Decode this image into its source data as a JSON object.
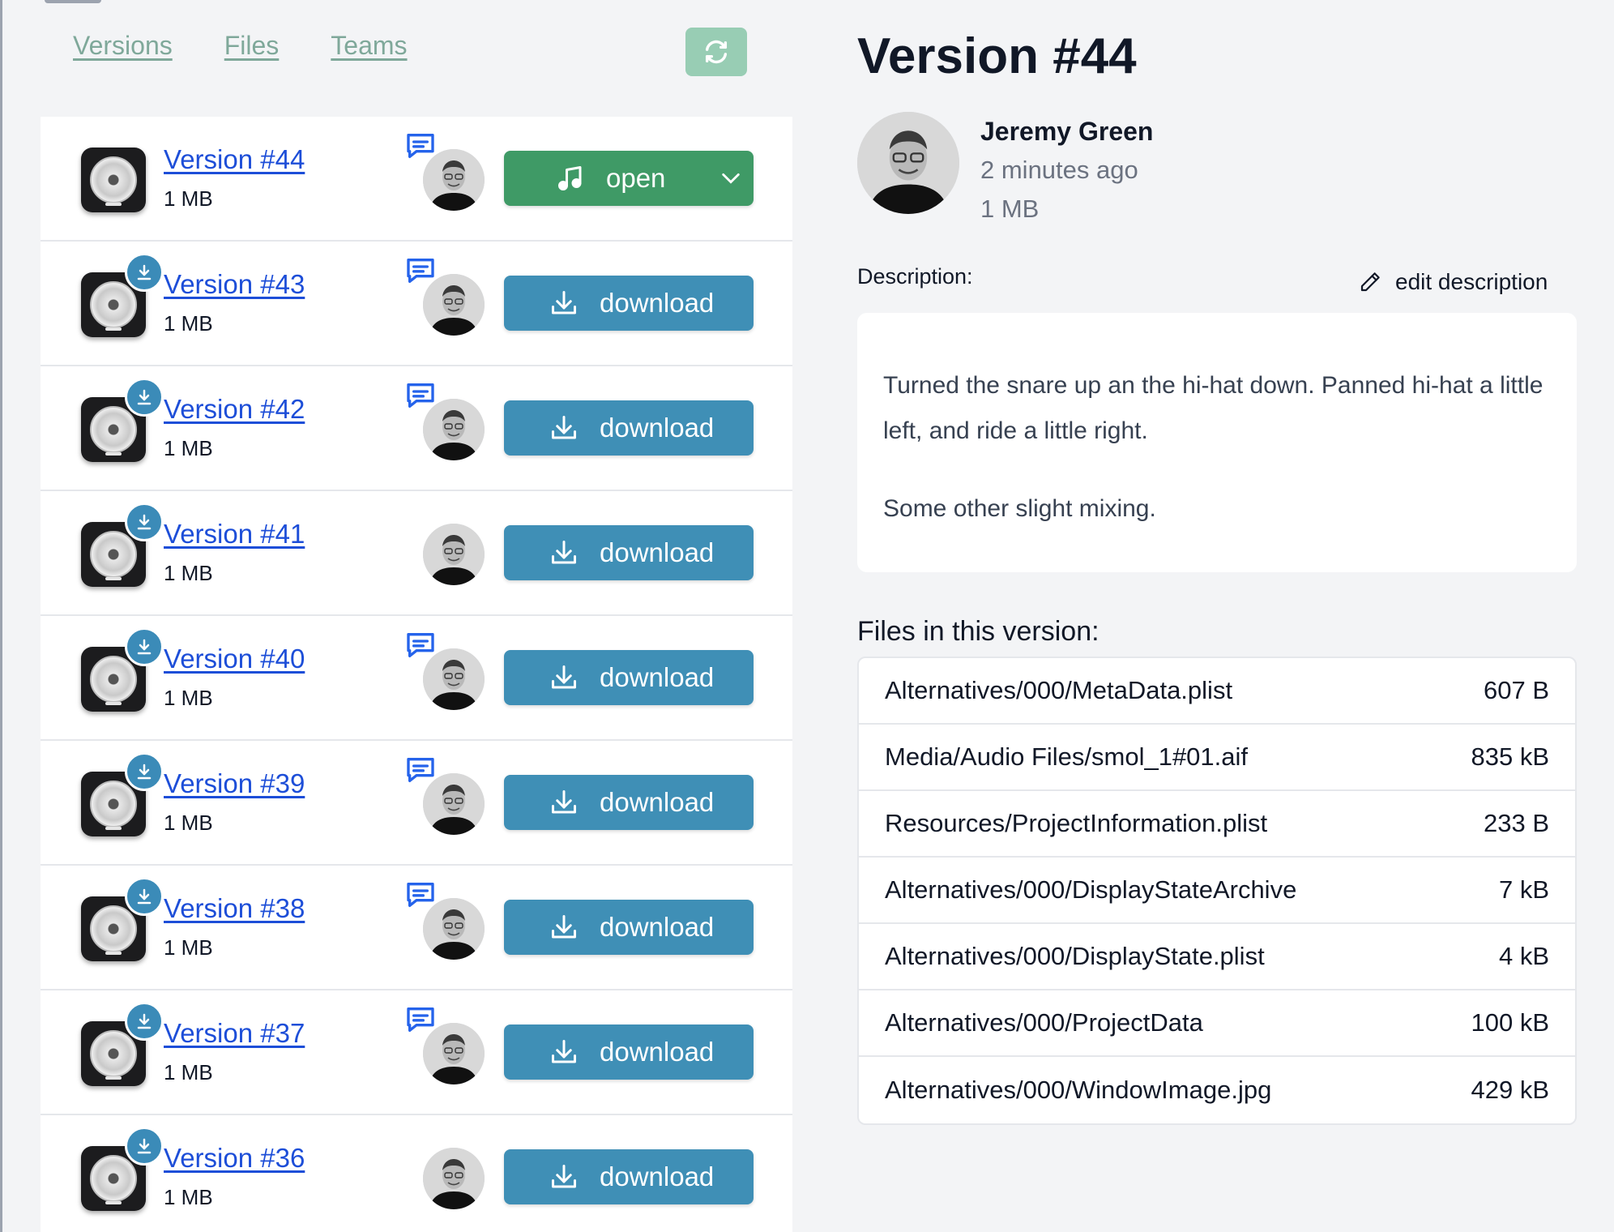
{
  "nav": {
    "tabs": [
      "Versions",
      "Files",
      "Teams"
    ]
  },
  "icons": {
    "refresh": "refresh-icon",
    "comment": "comment-icon",
    "download": "download-icon",
    "music": "music-note-icon",
    "chevron": "chevron-down-icon",
    "pencil": "pencil-icon",
    "app": "logic-pro-icon"
  },
  "colors": {
    "open_button": "#3f9a66",
    "download_button": "#3f8fb6",
    "link": "#1d4ed8",
    "nav_link": "#7fa89a",
    "refresh_button": "#98cdb4"
  },
  "versions": [
    {
      "title": "Version #44",
      "size": "1 MB",
      "action": "open",
      "comment": true,
      "badge": false
    },
    {
      "title": "Version #43",
      "size": "1 MB",
      "action": "download",
      "comment": true,
      "badge": true
    },
    {
      "title": "Version #42",
      "size": "1 MB",
      "action": "download",
      "comment": true,
      "badge": true
    },
    {
      "title": "Version #41",
      "size": "1 MB",
      "action": "download",
      "comment": false,
      "badge": true
    },
    {
      "title": "Version #40",
      "size": "1 MB",
      "action": "download",
      "comment": true,
      "badge": true
    },
    {
      "title": "Version #39",
      "size": "1 MB",
      "action": "download",
      "comment": true,
      "badge": true
    },
    {
      "title": "Version #38",
      "size": "1 MB",
      "action": "download",
      "comment": true,
      "badge": true
    },
    {
      "title": "Version #37",
      "size": "1 MB",
      "action": "download",
      "comment": true,
      "badge": true
    },
    {
      "title": "Version #36",
      "size": "1 MB",
      "action": "download",
      "comment": false,
      "badge": true
    }
  ],
  "detail": {
    "title": "Version #44",
    "author": "Jeremy Green",
    "time_ago": "2 minutes ago",
    "size": "1 MB",
    "description_label": "Description:",
    "edit_label": "edit description",
    "description": [
      "Turned the snare up an the hi-hat down. Panned hi-hat a little left, and ride a little right.",
      "Some other slight mixing."
    ],
    "files_label": "Files in this version:",
    "files": [
      {
        "name": "Alternatives/000/MetaData.plist",
        "size": "607 B"
      },
      {
        "name": "Media/Audio Files/smol_1#01.aif",
        "size": "835 kB"
      },
      {
        "name": "Resources/ProjectInformation.plist",
        "size": "233 B"
      },
      {
        "name": "Alternatives/000/DisplayStateArchive",
        "size": "7 kB"
      },
      {
        "name": "Alternatives/000/DisplayState.plist",
        "size": "4 kB"
      },
      {
        "name": "Alternatives/000/ProjectData",
        "size": "100 kB"
      },
      {
        "name": "Alternatives/000/WindowImage.jpg",
        "size": "429 kB"
      }
    ]
  }
}
